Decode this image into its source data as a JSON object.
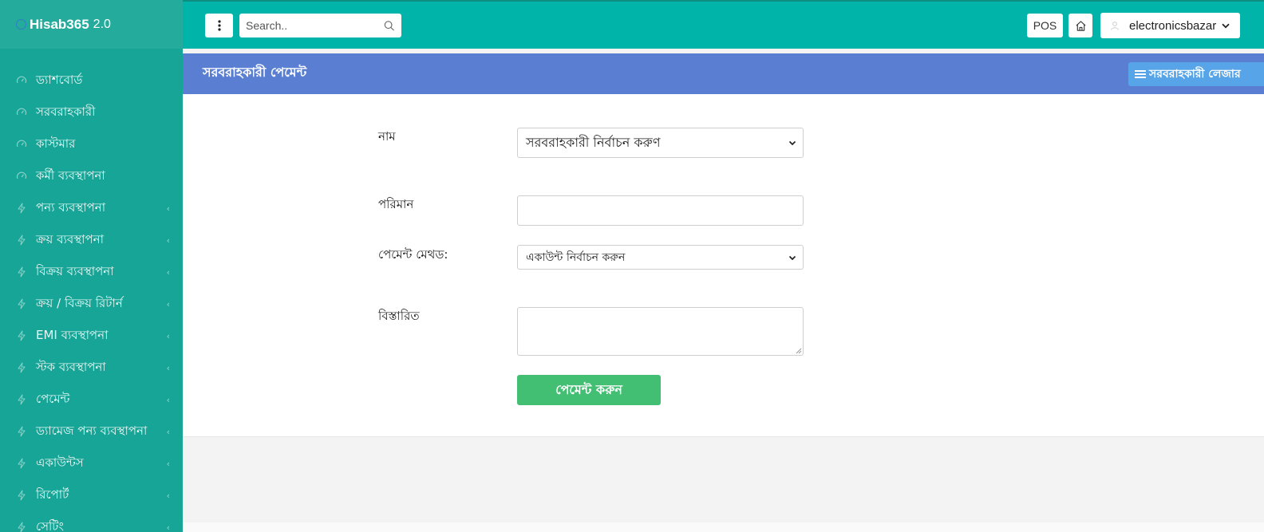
{
  "brand": {
    "name": "Hisab365",
    "version": "2.0"
  },
  "sidebar": {
    "items": [
      {
        "label": "ড্যাশবোর্ড",
        "icon": "gauge-icon",
        "has_submenu": false
      },
      {
        "label": "সরবরাহকারী",
        "icon": "gauge-icon",
        "has_submenu": false
      },
      {
        "label": "কাস্টমার",
        "icon": "gauge-icon",
        "has_submenu": false
      },
      {
        "label": "কর্মী ব্যবস্থাপনা",
        "icon": "gauge-icon",
        "has_submenu": false
      },
      {
        "label": "পন্য ব্যবস্থাপনা",
        "icon": "bolt-icon",
        "has_submenu": true
      },
      {
        "label": "ক্রয় ব্যবস্থাপনা",
        "icon": "bolt-icon",
        "has_submenu": true
      },
      {
        "label": "বিক্রয় ব্যবস্থাপনা",
        "icon": "bolt-icon",
        "has_submenu": true
      },
      {
        "label": "ক্রয় / বিক্রয় রিটার্ন",
        "icon": "bolt-icon",
        "has_submenu": true
      },
      {
        "label": "EMI ব্যবস্থাপনা",
        "icon": "bolt-icon",
        "has_submenu": true
      },
      {
        "label": "স্টক ব্যবস্থাপনা",
        "icon": "bolt-icon",
        "has_submenu": true
      },
      {
        "label": "পেমেন্ট",
        "icon": "bolt-icon",
        "has_submenu": true
      },
      {
        "label": "ড্যামেজ পন্য ব্যবস্থাপনা",
        "icon": "bolt-icon",
        "has_submenu": true
      },
      {
        "label": "একাউন্টস",
        "icon": "bolt-icon",
        "has_submenu": true
      },
      {
        "label": "রিপোর্ট",
        "icon": "bolt-icon",
        "has_submenu": true
      },
      {
        "label": "সেটিং",
        "icon": "bolt-icon",
        "has_submenu": true
      }
    ],
    "chevron": "‹"
  },
  "topbar": {
    "search_placeholder": "Search..",
    "pos_label": "POS",
    "username": "electronicsbazar"
  },
  "page": {
    "title": "সরবরাহকারী পেমেন্ট",
    "ledger_button": "সরবরাহকারী লেজার"
  },
  "form": {
    "name_label": "নাম",
    "name_select_value": "সরবরাহকারী নির্বাচন করুণ",
    "amount_label": "পরিমান",
    "amount_value": "",
    "method_label": "পেমেন্ট মেথড:",
    "method_select_value": "একাউন্ট নির্বাচন করুন",
    "details_label": "বিস্তারিত",
    "details_value": "",
    "submit_label": "পেমেন্ট করুন"
  },
  "colors": {
    "sidebar": "#16a596",
    "topbar": "#01b4a9",
    "header": "#5a7fd2",
    "ledger_button": "#57a5e8",
    "submit": "#42bf73"
  }
}
